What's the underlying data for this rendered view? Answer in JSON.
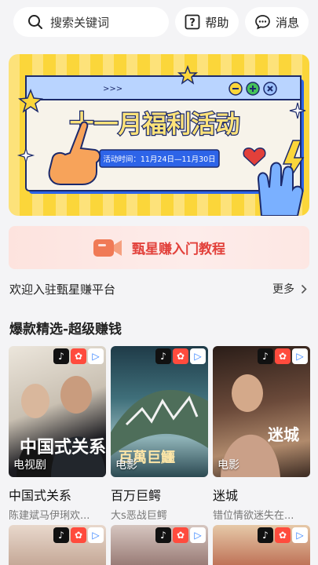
{
  "search": {
    "placeholder": "搜索关键词"
  },
  "header": {
    "help_label": "帮助",
    "message_label": "消息"
  },
  "banner": {
    "title": "十一月福利活动",
    "time_label": "活动时间：11月24日—11月30日",
    "arrows": ">>>"
  },
  "tutorial": {
    "label": "甄星赚入门教程"
  },
  "welcome": {
    "text": "欢迎入驻甄星赚平台",
    "more_label": "更多"
  },
  "section": {
    "title": "爆款精选-超级赚钱"
  },
  "platform_icons": [
    "tiktok-icon",
    "kuaishou-icon",
    "bilibili-icon"
  ],
  "cards": [
    {
      "title": "中国式关系",
      "desc": "陈建斌马伊琍欢...",
      "tag": "电视剧",
      "poster_text": "中国式关系",
      "accent": "#c8c2b8"
    },
    {
      "title": "百万巨鳄",
      "desc": "大s恶战巨鳄",
      "tag": "电影",
      "poster_text": "百萬巨鱷",
      "accent": "#3f6f7a"
    },
    {
      "title": "迷城",
      "desc": "错位情欲迷失在...",
      "tag": "电影",
      "poster_text": "迷城",
      "accent": "#6b4a3a"
    }
  ],
  "colors": {
    "accent_red": "#e2403a",
    "banner_yellow": "#fbd63a",
    "banner_blue": "#2d64e8"
  }
}
